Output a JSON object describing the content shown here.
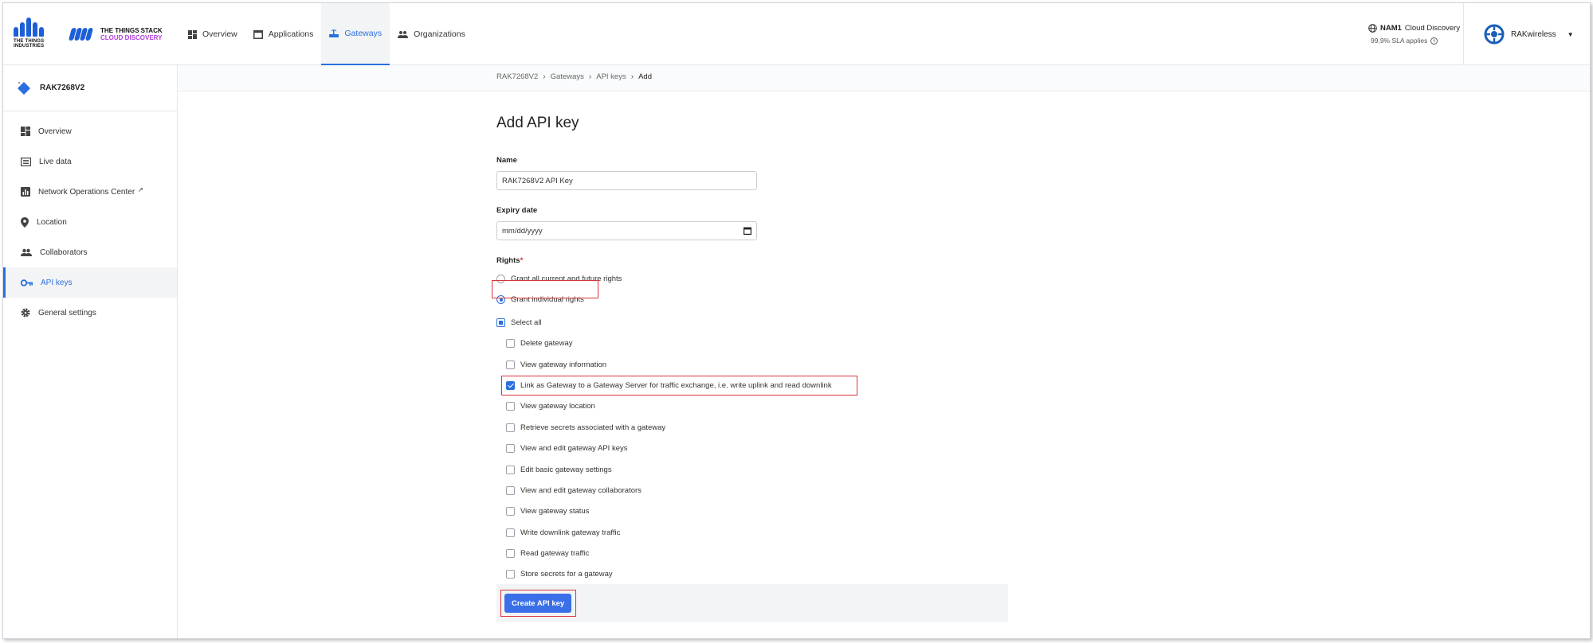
{
  "header": {
    "tti_logo_text": "THE THINGS INDUSTRIES",
    "stack_title": "THE THINGS STACK",
    "stack_subtitle": "CLOUD DISCOVERY",
    "nav": [
      {
        "label": "Overview",
        "icon": "dashboard-icon"
      },
      {
        "label": "Applications",
        "icon": "window-icon"
      },
      {
        "label": "Gateways",
        "icon": "gateway-icon"
      },
      {
        "label": "Organizations",
        "icon": "people-icon"
      }
    ],
    "cluster_name": "NAM1",
    "cluster_label": "Cloud Discovery",
    "sla": "99.9% SLA applies",
    "user": "RAKwireless"
  },
  "sidebar": {
    "gateway_name": "RAK7268V2",
    "items": [
      {
        "label": "Overview"
      },
      {
        "label": "Live data"
      },
      {
        "label": "Network Operations Center"
      },
      {
        "label": "Location"
      },
      {
        "label": "Collaborators"
      },
      {
        "label": "API keys"
      },
      {
        "label": "General settings"
      }
    ]
  },
  "breadcrumb": {
    "items": [
      "RAK7268V2",
      "Gateways",
      "API keys",
      "Add"
    ]
  },
  "form": {
    "title": "Add API key",
    "name_label": "Name",
    "name_value": "RAK7268V2 API Key",
    "expiry_label": "Expiry date",
    "expiry_placeholder": "mm/dd/yyyy",
    "rights_label": "Rights",
    "rights_required_mark": "*",
    "grant_all": "Grant all current and future rights",
    "grant_individual": "Grant individual rights",
    "select_all": "Select all",
    "rights": [
      {
        "label": "Delete gateway",
        "checked": false
      },
      {
        "label": "View gateway information",
        "checked": false
      },
      {
        "label": "Link as Gateway to a Gateway Server for traffic exchange, i.e. write uplink and read downlink",
        "checked": true
      },
      {
        "label": "View gateway location",
        "checked": false
      },
      {
        "label": "Retrieve secrets associated with a gateway",
        "checked": false
      },
      {
        "label": "View and edit gateway API keys",
        "checked": false
      },
      {
        "label": "Edit basic gateway settings",
        "checked": false
      },
      {
        "label": "View and edit gateway collaborators",
        "checked": false
      },
      {
        "label": "View gateway status",
        "checked": false
      },
      {
        "label": "Write downlink gateway traffic",
        "checked": false
      },
      {
        "label": "Read gateway traffic",
        "checked": false
      },
      {
        "label": "Store secrets for a gateway",
        "checked": false
      }
    ],
    "submit_label": "Create API key"
  },
  "colors": {
    "accent": "#2b6fe0",
    "highlight": "#d9343a"
  }
}
